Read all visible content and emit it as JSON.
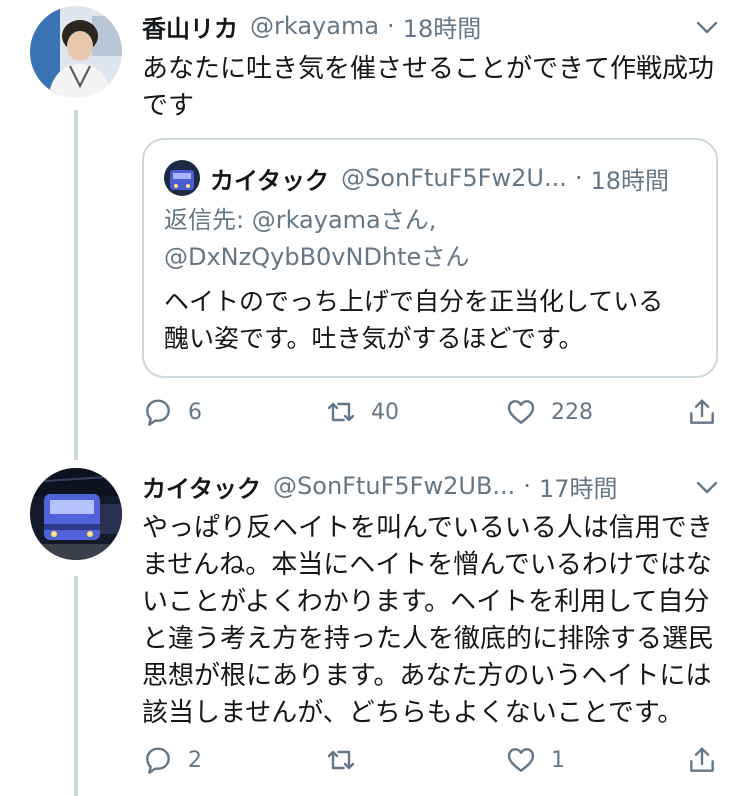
{
  "tweets": [
    {
      "name": "香山リカ",
      "handle": "@rkayama",
      "time": "18時間",
      "text_line1": "あなたに吐き気を催させることができて作戦成功",
      "text_line2": "です",
      "quote": {
        "name": "カイタック",
        "handle": "@SonFtuF5Fw2U...",
        "time": "18時間",
        "reply_line1": "返信先: @rkayamaさん,",
        "reply_line2": "@DxNzQybB0vNDhteさん",
        "text_line1": "ヘイトのでっち上げで自分を正当化している",
        "text_line2": "醜い姿です。吐き気がするほどです。"
      },
      "actions": {
        "reply_count": "6",
        "retweet_count": "40",
        "like_count": "228"
      }
    },
    {
      "name": "カイタック",
      "handle": "@SonFtuF5Fw2UB...",
      "time": "17時間",
      "lines": [
        "やっぱり反ヘイトを叫んでいるいる人は信用でき",
        "ませんね。本当にヘイトを憎んでいるわけではな",
        "いことがよくわかります。ヘイトを利用して自分",
        "と違う考え方を持った人を徹底的に排除する選民",
        "思想が根にあります。あなた方のいうヘイトには",
        "該当しませんが、どちらもよくないことです。"
      ],
      "actions": {
        "reply_count": "2",
        "retweet_count": "",
        "like_count": "1"
      }
    }
  ],
  "separator": "·",
  "icons": [
    "caret-down-icon",
    "reply-icon",
    "retweet-icon",
    "like-icon",
    "share-icon"
  ],
  "colors": {
    "text": "#14171a",
    "secondary": "#657786",
    "line": "#ccd6dd"
  }
}
